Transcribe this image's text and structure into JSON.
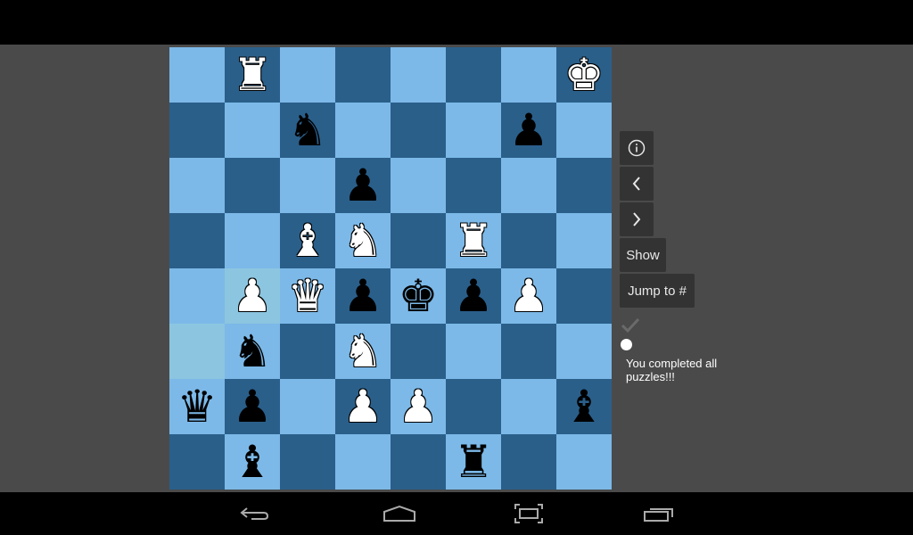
{
  "board": {
    "colors": {
      "light": "#7cb9e8",
      "dark": "#2a5f8a",
      "highlight": "#8cc5e0"
    },
    "highlighted_squares": [
      [
        4,
        1
      ],
      [
        5,
        0
      ]
    ],
    "rows": [
      [
        "",
        "wR",
        "",
        "",
        "",
        "",
        "",
        "wK"
      ],
      [
        "",
        "",
        "bN",
        "",
        "",
        "",
        "bP",
        ""
      ],
      [
        "",
        "",
        "",
        "bP",
        "",
        "",
        "",
        ""
      ],
      [
        "",
        "",
        "wB",
        "wN",
        "",
        "wR",
        "",
        ""
      ],
      [
        "",
        "wP",
        "wQ",
        "bP",
        "bK",
        "bP",
        "wP",
        ""
      ],
      [
        "",
        "bN",
        "",
        "wN",
        "",
        "",
        "",
        ""
      ],
      [
        "bQ",
        "bP",
        "",
        "wP",
        "wP",
        "",
        "",
        "bB"
      ],
      [
        "",
        "bB",
        "",
        "",
        "",
        "bR",
        "",
        ""
      ]
    ]
  },
  "glyphs": {
    "K": "♚",
    "Q": "♛",
    "R": "♜",
    "B": "♝",
    "N": "♞",
    "P": "♟"
  },
  "sidebar": {
    "info_icon": "ⓘ",
    "prev_icon": "‹",
    "next_icon": "›",
    "show_label": "Show",
    "jump_label": "Jump to #",
    "message": "You completed all puzzles!!!"
  },
  "navbar": {
    "back": "back-icon",
    "home": "home-icon",
    "screenshot": "screenshot-icon",
    "recents": "recents-icon"
  }
}
